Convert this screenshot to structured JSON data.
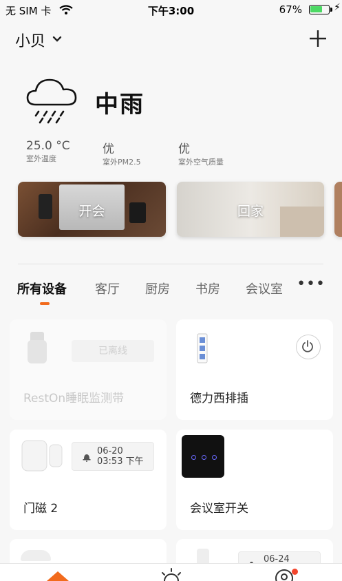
{
  "status_bar": {
    "carrier": "无 SIM 卡",
    "time": "下午3:00",
    "battery_percent": "67%",
    "battery_level": 0.67
  },
  "header": {
    "home_name": "小贝"
  },
  "weather": {
    "condition": "中雨",
    "stats": [
      {
        "value": "25.0 °C",
        "label": "室外温度"
      },
      {
        "value": "优",
        "label": "室外PM2.5"
      },
      {
        "value": "优",
        "label": "室外空气质量"
      }
    ]
  },
  "scenes": [
    {
      "label": "开会"
    },
    {
      "label": "回家"
    }
  ],
  "tabs": [
    {
      "label": "所有设备",
      "active": true
    },
    {
      "label": "客厅"
    },
    {
      "label": "厨房"
    },
    {
      "label": "书房"
    },
    {
      "label": "会议室"
    }
  ],
  "more_label": "•••",
  "devices": [
    {
      "name": "RestOn睡眠监测带",
      "status": "已离线"
    },
    {
      "name": "德力西排插"
    },
    {
      "name": "门磁 2",
      "date": "06-20",
      "time": "03:53 下午"
    },
    {
      "name": "会议室开关"
    },
    {
      "name": "",
      "date": "06-24"
    }
  ],
  "colors": {
    "accent": "#f26b1d",
    "battery_green": "#4cd964",
    "background": "#f7f7f7"
  }
}
